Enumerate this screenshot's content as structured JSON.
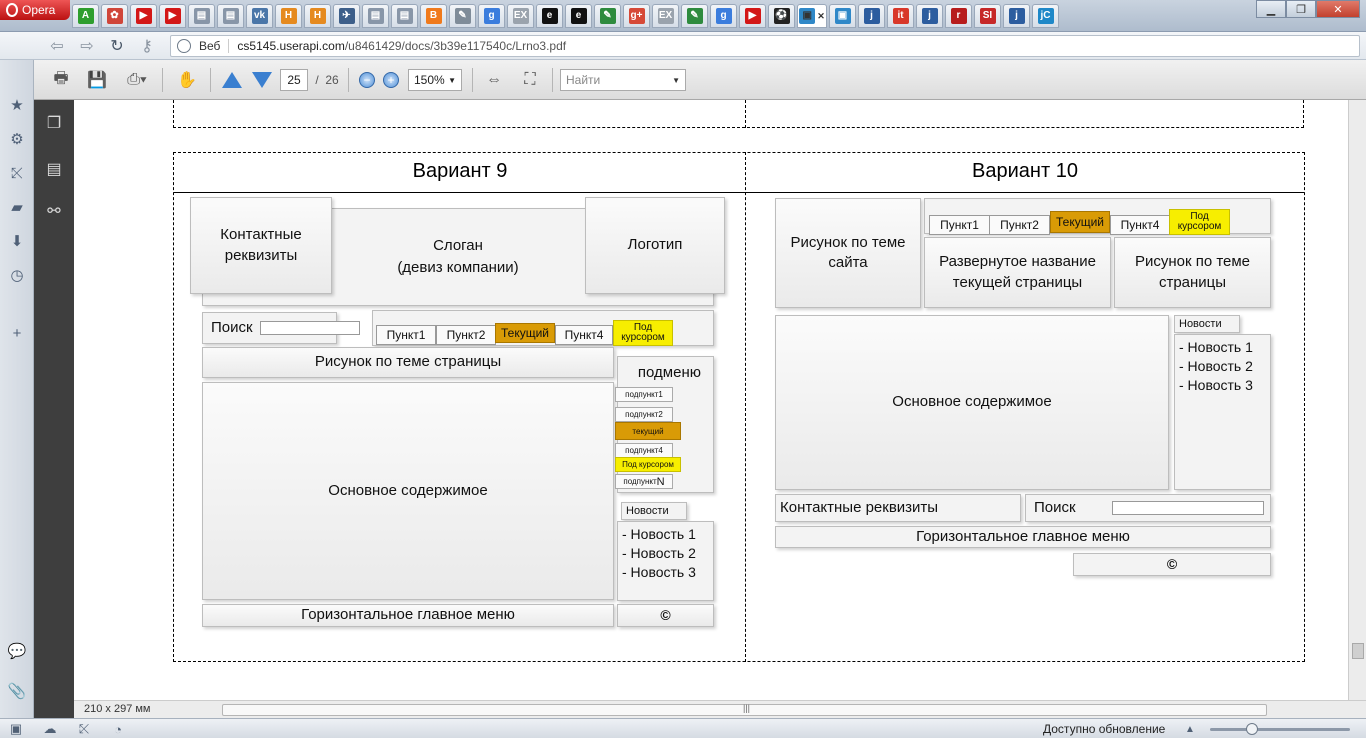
{
  "browser": {
    "menu_label": "Opera",
    "tabs": [
      {
        "icon": "a-icon",
        "glyph": "A",
        "color": "#2e9e2e"
      },
      {
        "icon": "bookmark-green-icon",
        "glyph": "✿",
        "color": "#d0463a"
      },
      {
        "icon": "youtube-icon",
        "glyph": "▶",
        "color": "#d31717"
      },
      {
        "icon": "youtube-icon",
        "glyph": "▶",
        "color": "#d31717"
      },
      {
        "icon": "page-icon",
        "glyph": "▤",
        "color": "#8896a8"
      },
      {
        "icon": "page-icon",
        "glyph": "▤",
        "color": "#8896a8"
      },
      {
        "icon": "vk-icon",
        "glyph": "vk",
        "color": "#4a76a8"
      },
      {
        "icon": "h-icon",
        "glyph": "H",
        "color": "#e58a1f"
      },
      {
        "icon": "h-icon",
        "glyph": "H",
        "color": "#e58a1f"
      },
      {
        "icon": "plane-icon",
        "glyph": "✈",
        "color": "#3d5f8a"
      },
      {
        "icon": "page-icon",
        "glyph": "▤",
        "color": "#8896a8"
      },
      {
        "icon": "page-icon",
        "glyph": "▤",
        "color": "#8896a8"
      },
      {
        "icon": "blogger-icon",
        "glyph": "B",
        "color": "#f07a1c"
      },
      {
        "icon": "tool-icon",
        "glyph": "✎",
        "color": "#7f8c99"
      },
      {
        "icon": "google-icon",
        "glyph": "g",
        "color": "#3b7ddd"
      },
      {
        "icon": "ex-icon",
        "glyph": "EX",
        "color": "#9aa3ad"
      },
      {
        "icon": "e-icon",
        "glyph": "e",
        "color": "#111111"
      },
      {
        "icon": "e-icon",
        "glyph": "e",
        "color": "#111111"
      },
      {
        "icon": "pencil-icon",
        "glyph": "✎",
        "color": "#2e8b3e"
      },
      {
        "icon": "google-plus-icon",
        "glyph": "g+",
        "color": "#d64937"
      },
      {
        "icon": "ex-icon",
        "glyph": "EX",
        "color": "#9aa3ad"
      },
      {
        "icon": "pencil-icon",
        "glyph": "✎",
        "color": "#2e8b3e"
      },
      {
        "icon": "google-icon",
        "glyph": "g",
        "color": "#3b7ddd"
      },
      {
        "icon": "youtube-icon",
        "glyph": "▶",
        "color": "#d31717"
      },
      {
        "icon": "ball-icon",
        "glyph": "⚽",
        "color": "#222222"
      },
      {
        "icon": "chat-icon",
        "glyph": "▣",
        "color": "#2f88c8"
      },
      {
        "icon": "chat-icon",
        "glyph": "▣",
        "color": "#2f88c8"
      },
      {
        "icon": "j-icon",
        "glyph": "j",
        "color": "#2c5d9f"
      },
      {
        "icon": "it-icon",
        "glyph": "it",
        "color": "#d8382a"
      },
      {
        "icon": "j-icon",
        "glyph": "j",
        "color": "#2c5d9f"
      },
      {
        "icon": "r-icon",
        "glyph": "r",
        "color": "#b71c1c"
      },
      {
        "icon": "s-icon",
        "glyph": "SI",
        "color": "#c62828"
      },
      {
        "icon": "j-icon",
        "glyph": "j",
        "color": "#2c5d9f"
      },
      {
        "icon": "jc-icon",
        "glyph": "jC",
        "color": "#1e88c8"
      }
    ],
    "active_tab_index": 25,
    "address": {
      "scope_label": "Веб",
      "host": "cs5145.userapi.com",
      "path": "/u8461429/docs/3b39e117540c/Lrno3.pdf"
    },
    "status": {
      "update_text": "Доступно обновление"
    }
  },
  "pdf_toolbar": {
    "current_page": "25",
    "page_separator": "/",
    "total_pages": "26",
    "zoom": "150%",
    "search_placeholder": "Найти"
  },
  "page_size_label": "210 x 297 мм",
  "variants": [
    {
      "title": "Вариант 9",
      "blocks": {
        "contacts": "Контактные реквизиты",
        "slogan_line1": "Слоган",
        "slogan_line2": "(девиз компании)",
        "logo": "Логотип",
        "search": "Поиск",
        "page_picture": "Рисунок по теме страницы",
        "submenu_title": "подменю",
        "main_content": "Основное содержимое",
        "news_tab": "Новости",
        "news": [
          "- Новость 1",
          "- Новость 2",
          "- Новость 3"
        ],
        "horizontal_menu": "Горизонтальное главное меню",
        "copyright": "©"
      },
      "menu": [
        "Пункт1",
        "Пункт2",
        "Текущий",
        "Пункт4",
        "Под курсором"
      ],
      "submenu": [
        "подпункт1",
        "подпункт2",
        "текущий",
        "подпункт4",
        "Под курсором",
        "подпункт"
      ]
    },
    {
      "title": "Вариант 10",
      "blocks": {
        "site_picture": "Рисунок по теме сайта",
        "page_name": "Развернутое название текущей страницы",
        "page_picture": "Рисунок по теме страницы",
        "main_content": "Основное содержимое",
        "news_tab": "Новости",
        "news": [
          "- Новость 1",
          "- Новость 2",
          "- Новость 3"
        ],
        "contacts": "Контактные реквизиты",
        "search": "Поиск",
        "horizontal_menu": "Горизонтальное главное меню",
        "copyright": "©"
      },
      "menu": [
        "Пункт1",
        "Пункт2",
        "Текущий",
        "Пункт4",
        "Под курсором"
      ]
    }
  ]
}
